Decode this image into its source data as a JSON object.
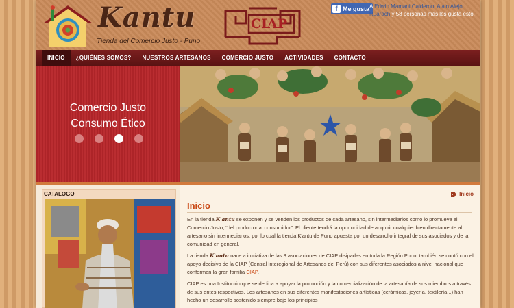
{
  "header": {
    "logo_title": "Kantu",
    "logo_subtitle": "Tienda del Comercio Justo - Puno",
    "partner_logo_text": "CIAP",
    "facebook": {
      "like_label": "Me gusta",
      "prefix": "A",
      "names": "Edwin Mamani Calderon, Alain Alejo Ruarach",
      "suffix": "y 58 personas más les gusta esto."
    }
  },
  "nav": {
    "items": [
      {
        "label": "INICIO",
        "active": true
      },
      {
        "label": "¿QUIÉNES SOMOS?"
      },
      {
        "label": "NUESTROS ARTESANOS"
      },
      {
        "label": "COMERCIO JUSTO"
      },
      {
        "label": "ACTIVIDADES"
      },
      {
        "label": "CONTACTO"
      }
    ]
  },
  "slider": {
    "line1": "Comercio Justo",
    "line2": "Consumo Ético",
    "dot_count": 4,
    "active_dot": 3
  },
  "sidebar": {
    "title": "CATALOGO"
  },
  "main": {
    "breadcrumb": "Inicio",
    "title": "Inicio",
    "p1": {
      "a": "En la tienda",
      "brand": "K'antu",
      "b": "se exponen y se venden los productos de cada artesano, sin intermediarios como lo promueve el Comercio Justo, “del productor al consumidor”. El cliente tendrá la oportunidad de adquirir cualquier bien directamente al artesano sin intermediarios; por lo cual la tienda K'antu de Puno apuesta por un desarrollo integral de sus asociados y de la comunidad en general."
    },
    "p2": {
      "a": "La tienda",
      "brand": "K'antu",
      "b": "nace a iniciativa de las 8 asociaciones de CIAP disipadas en toda la Región Puno, también se contó con el apoyo decisivo de la CIAP (Central Interegional de Artesanos del Perú) con sus diferentes asociados a nivel nacional que conforman la gran familia",
      "link": "CIAP",
      "c": "."
    },
    "p3": "CIAP es una Institución que se dedica a apoyar la promoción y la comercialización de la artesanía de sus miembros a través de sus entes respectivos. Los artesanos en sus diferentes manifestaciones artísticas (cerámicas, joyería, textilería...) han hecho un desarrollo sostenido siempre bajo los principios"
  },
  "colors": {
    "nav_bg": "#6b1818",
    "accent_orange": "#c94814",
    "slider_red": "#b8262a",
    "header_brown": "#c98a5a"
  }
}
